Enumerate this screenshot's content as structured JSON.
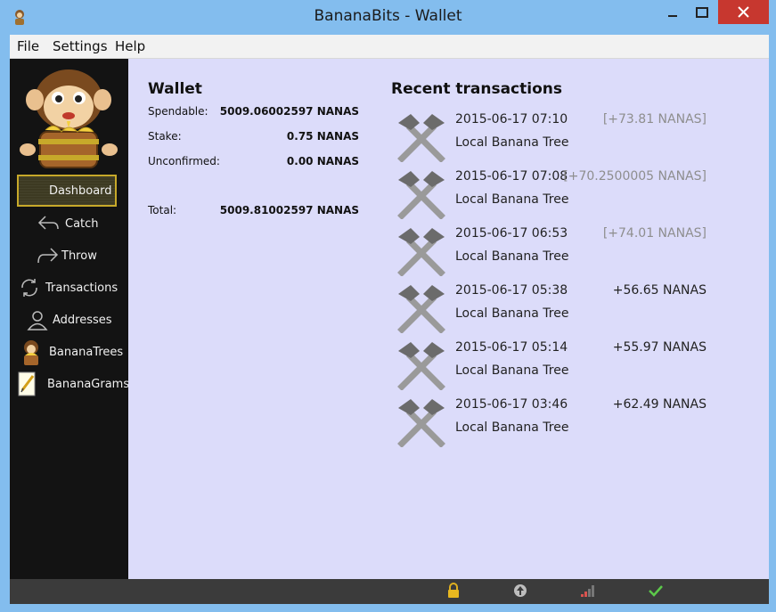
{
  "window": {
    "title": "BananaBits - Wallet"
  },
  "menu": [
    "File",
    "Settings",
    "Help"
  ],
  "sidebar": {
    "items": [
      {
        "label": "Dashboard",
        "icon": "dashboard-icon",
        "active": true
      },
      {
        "label": "Catch",
        "icon": "catch-arrow-icon"
      },
      {
        "label": "Throw",
        "icon": "throw-arrow-icon"
      },
      {
        "label": "Transactions",
        "icon": "transactions-refresh-icon"
      },
      {
        "label": "Addresses",
        "icon": "addresses-user-icon"
      },
      {
        "label": "BananaTrees",
        "icon": "monkey-icon"
      },
      {
        "label": "BananaGrams",
        "icon": "notepad-icon"
      }
    ]
  },
  "wallet": {
    "title": "Wallet",
    "spendable_label": "Spendable:",
    "spendable_value": "5009.06002597 NANAS",
    "stake_label": "Stake:",
    "stake_value": "0.75 NANAS",
    "unconfirmed_label": "Unconfirmed:",
    "unconfirmed_value": "0.00 NANAS",
    "total_label": "Total:",
    "total_value": "5009.81002597 NANAS"
  },
  "recent": {
    "title": "Recent transactions",
    "items": [
      {
        "date": "2015-06-17 07:10",
        "amount": "[+73.81 NANAS]",
        "label": "Local Banana Tree",
        "pending": true
      },
      {
        "date": "2015-06-17 07:08",
        "amount": "[+70.2500005 NANAS]",
        "label": "Local Banana Tree",
        "pending": true
      },
      {
        "date": "2015-06-17 06:53",
        "amount": "[+74.01 NANAS]",
        "label": "Local Banana Tree",
        "pending": true
      },
      {
        "date": "2015-06-17 05:38",
        "amount": "+56.65 NANAS",
        "label": "Local Banana Tree",
        "pending": false
      },
      {
        "date": "2015-06-17 05:14",
        "amount": "+55.97 NANAS",
        "label": "Local Banana Tree",
        "pending": false
      },
      {
        "date": "2015-06-17 03:46",
        "amount": "+62.49 NANAS",
        "label": "Local Banana Tree",
        "pending": false
      }
    ]
  },
  "status_icons": [
    "lock-icon",
    "sync-icon",
    "signal-bars-icon",
    "checkmark-icon"
  ],
  "colors": {
    "accent_border": "#c7a92a",
    "sidebar_bg": "#131313",
    "main_bg": "#dcdcfa",
    "pending_text": "#8e8e8e",
    "close_button": "#c7372f"
  }
}
